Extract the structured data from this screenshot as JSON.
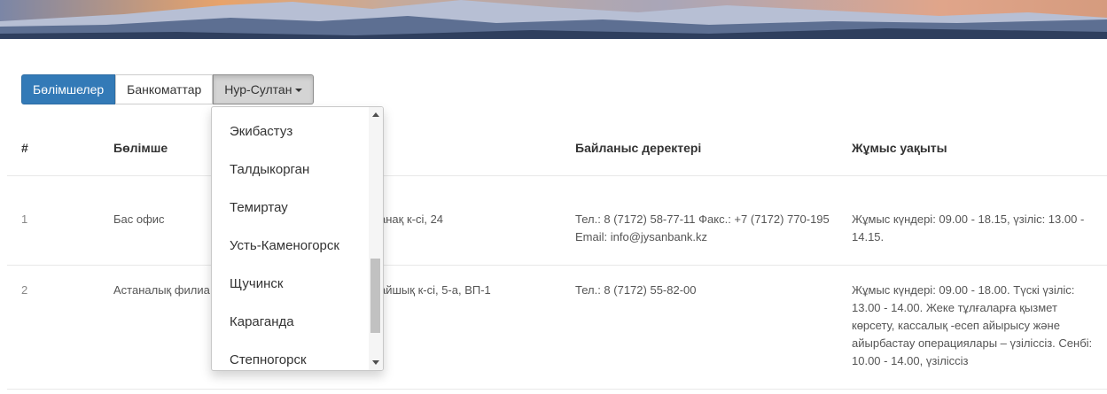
{
  "tabs": {
    "branches_label": "Бөлімшелер",
    "atms_label": "Банкоматтар",
    "city_selected": "Нур-Султан"
  },
  "table": {
    "headers": [
      "#",
      "Бөлімше",
      "Байланыс деректері",
      "Жұмыс уақыты"
    ],
    "rows": [
      {
        "num": "1",
        "name": "Бас офис",
        "address": "анақ к-сі, 24",
        "contacts": "Тел.: 8 (7172) 58-77-11 Факс.: +7 (7172) 770-195 Email: info@jysanbank.kz",
        "hours": "Жұмыс күндері: 09.00 - 18.15, үзіліс: 13.00 - 14.15."
      },
      {
        "num": "2",
        "name": "Астаналық филиа",
        "address": "айшық к-сі, 5-а, ВП-1",
        "contacts": "Тел.: 8 (7172) 55-82-00",
        "hours": "Жұмыс күндері: 09.00 - 18.00. Түскі үзіліс: 13.00 - 14.00. Жеке тұлғаларға қызмет көрсету, кассалық -есеп айырысу және айырбастау операциялары – үзіліссіз. Сенбі: 10.00 - 14.00, үзіліссіз"
      }
    ]
  },
  "city_dropdown": {
    "options": [
      "Экибастуз",
      "Талдыкорган",
      "Темиртау",
      "Усть-Каменогорск",
      "Щучинск",
      "Караганда",
      "Степногорск"
    ]
  },
  "colors": {
    "accent": "#337ab7",
    "toggle_active": "#d4d4d4"
  },
  "icons": {
    "caret": "caret-down-icon",
    "scroll_up": "scroll-up-arrow-icon",
    "scroll_down": "scroll-down-arrow-icon"
  }
}
